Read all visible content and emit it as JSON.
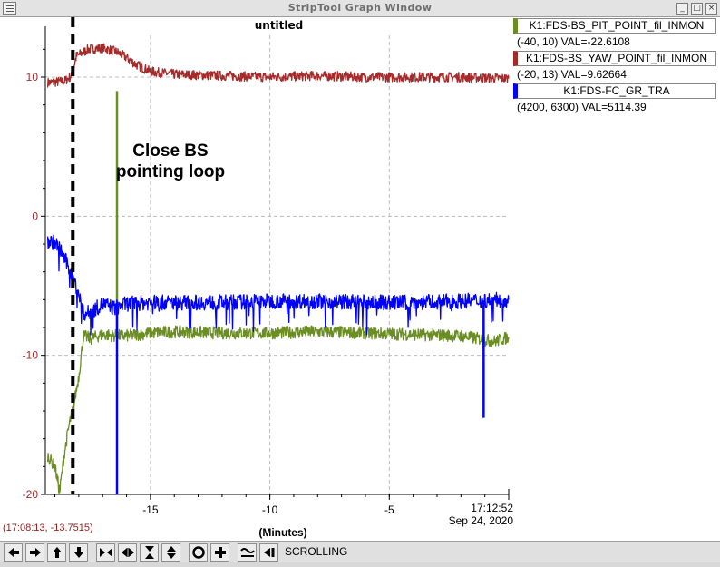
{
  "window": {
    "title": "StripTool Graph Window",
    "controls": [
      "minimize-icon",
      "maximize-icon",
      "close-icon"
    ]
  },
  "graph": {
    "title": "untitled",
    "annotation_line1": "Close BS",
    "annotation_line2": "pointing loop",
    "pointer_readout": "(17:08:13, -13.7515)",
    "x_unit_label": "(Minutes)",
    "time_label": "17:12:52",
    "date_label": "Sep 24, 2020"
  },
  "legend": [
    {
      "name": "K1:FDS-BS_PIT_POINT_fil_INMON",
      "range": "(-40, 10) VAL=-22.6108",
      "color": "#6b8e23"
    },
    {
      "name": "K1:FDS-BS_YAW_POINT_fil_INMON",
      "range": "(-20, 13) VAL=9.62664",
      "color": "#a52a2a"
    },
    {
      "name": "K1:FDS-FC_GR_TRA",
      "range": "(4200, 6300) VAL=5114.39",
      "color": "#0000ff"
    }
  ],
  "toolbar": {
    "mode_label": "SCROLLING",
    "buttons": [
      "arrow-left-icon",
      "arrow-right-icon",
      "arrow-up-icon",
      "arrow-down-icon",
      "zoom-in-horizontal-icon",
      "zoom-out-horizontal-icon",
      "zoom-in-vertical-icon",
      "zoom-out-vertical-icon",
      "auto-scale-icon",
      "add-signal-icon",
      "refresh-icon",
      "last-icon"
    ]
  },
  "chart_data": {
    "type": "line",
    "title": "untitled",
    "xlabel": "(Minutes)",
    "ylabel": "",
    "x_tick_labels": [
      "-15",
      "-10",
      "-5",
      "17:12:52"
    ],
    "y_tick_labels": [
      "10",
      "0",
      "-10",
      "-20"
    ],
    "xlim": [
      -19.4,
      0
    ],
    "ylim": [
      -20,
      13
    ],
    "grid": true,
    "y_axis_color": "#a52a2a",
    "events": [
      {
        "label": "Close BS pointing loop",
        "x": -18.25,
        "style": "dashed-black"
      }
    ],
    "series": [
      {
        "name": "K1:FDS-BS_YAW_POINT_fil_INMON",
        "color": "#a52a2a",
        "x": [
          -19.3,
          -18.6,
          -18.3,
          -18.1,
          -17.6,
          -17.0,
          -16.4,
          -16.0,
          -15.6,
          -15.0,
          -14.0,
          -12.0,
          -10.0,
          -8.0,
          -6.0,
          -4.0,
          -2.0,
          0
        ],
        "values": [
          9.6,
          9.7,
          10.1,
          11.5,
          12.0,
          12.1,
          11.8,
          11.4,
          10.9,
          10.4,
          10.2,
          10.1,
          10.0,
          10.1,
          10.0,
          10.0,
          10.0,
          9.9
        ]
      },
      {
        "name": "K1:FDS-BS_PIT_POINT_fil_INMON",
        "color": "#6b8e23",
        "x": [
          -19.3,
          -19.0,
          -18.8,
          -18.6,
          -18.4,
          -18.2,
          -18.0,
          -17.8,
          -17.5,
          -17.0,
          -16.5,
          -16.0,
          -15.0,
          -14.0,
          -12.0,
          -10.0,
          -8.0,
          -6.0,
          -4.0,
          -2.0,
          -0.6,
          0
        ],
        "values": [
          -17.2,
          -18.0,
          -19.8,
          -17.0,
          -15.0,
          -13.5,
          -11.5,
          -8.6,
          -8.8,
          -8.5,
          -8.6,
          -8.6,
          -8.4,
          -8.3,
          -8.4,
          -8.4,
          -8.3,
          -8.4,
          -8.5,
          -8.6,
          -9.0,
          -8.7
        ],
        "spikes": [
          {
            "x": -16.4,
            "value": 9.0
          }
        ]
      },
      {
        "name": "K1:FDS-FC_GR_TRA",
        "color": "#0000ff",
        "x": [
          -19.3,
          -19.0,
          -18.7,
          -18.4,
          -18.2,
          -18.0,
          -17.8,
          -17.5,
          -17.0,
          -16.5,
          -16.0,
          -15.0,
          -14.0,
          -12.0,
          -10.0,
          -8.0,
          -6.0,
          -4.0,
          -2.0,
          0
        ],
        "values": [
          -1.8,
          -1.9,
          -2.6,
          -3.8,
          -4.6,
          -5.6,
          -7.0,
          -6.9,
          -6.3,
          -6.6,
          -6.3,
          -6.2,
          -6.2,
          -6.2,
          -6.1,
          -6.1,
          -6.2,
          -6.2,
          -6.1,
          -6.0
        ],
        "spikes": [
          {
            "x": -16.4,
            "value": -20.0
          },
          {
            "x": -1.05,
            "value": -14.5
          }
        ]
      }
    ]
  }
}
